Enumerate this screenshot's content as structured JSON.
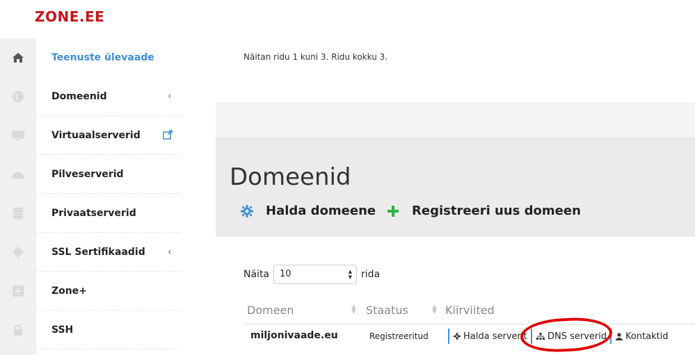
{
  "brand": {
    "logo_text": "ZONE.EE",
    "color": "#c4161c"
  },
  "sidebar": {
    "items": [
      {
        "label": "Teenuste ülevaade",
        "icon": "home-icon",
        "active": true
      },
      {
        "label": "Domeenid",
        "icon": "globe-icon",
        "expandable": true
      },
      {
        "label": "Virtuaalserverid",
        "icon": "monitor-icon",
        "external": true
      },
      {
        "label": "Pilveserverid",
        "icon": "cloud-icon"
      },
      {
        "label": "Privaatserverid",
        "icon": "database-icon"
      },
      {
        "label": "SSL Sertifikaadid",
        "icon": "certificate-icon",
        "expandable": true
      },
      {
        "label": "Zone+",
        "icon": "plus-square-icon"
      },
      {
        "label": "SSH",
        "icon": "lock-icon"
      }
    ],
    "chevron": "‹"
  },
  "content": {
    "showing_text": "Näitan ridu 1 kuni 3. Ridu kokku 3.",
    "page_title": "Domeenid",
    "actions": [
      {
        "label": "Halda domeene",
        "icon": "gear-icon"
      },
      {
        "label": "Registreeri uus domeen",
        "icon": "plus-icon"
      }
    ],
    "length_menu": {
      "prefix": "Näita",
      "value": "10",
      "suffix": "rida"
    },
    "table": {
      "columns": [
        "Domeen",
        "Staatus",
        "Kiirviited"
      ],
      "rows": [
        {
          "domain": "miljonivaade.eu",
          "status": "Registreeritud",
          "links": [
            {
              "label": "Halda serverit",
              "icon": "cog-icon"
            },
            {
              "label": "DNS serverid",
              "icon": "sitemap-icon"
            },
            {
              "label": "Kontaktid",
              "icon": "user-icon"
            }
          ]
        }
      ]
    }
  },
  "colors": {
    "accent": "#3d8fd6",
    "green": "#2db34a",
    "highlight": "#e00000"
  }
}
